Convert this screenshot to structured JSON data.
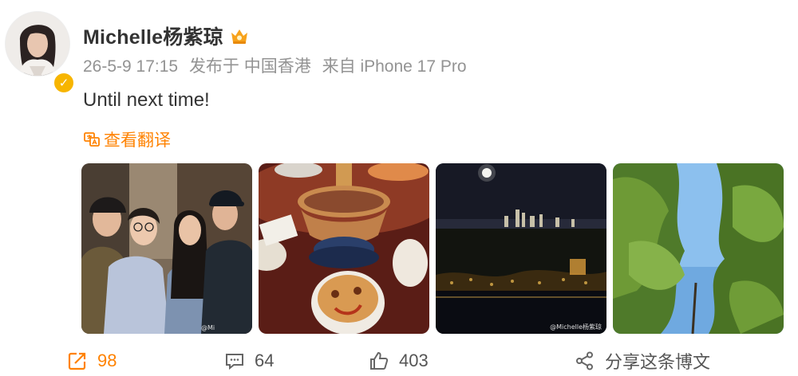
{
  "post": {
    "author_name": "Michelle杨紫琼",
    "meta": {
      "date": "26-5-9 17:15",
      "location": "发布于 中国香港",
      "source": "来自 iPhone 17 Pro"
    },
    "text": "Until next time!",
    "translate_label": "查看翻译",
    "photos": [
      {
        "name": "group-photo",
        "watermark": "@Mi"
      },
      {
        "name": "hotpot-photo",
        "watermark": ""
      },
      {
        "name": "night-city-photo",
        "watermark": "@Michelle杨紫琼"
      },
      {
        "name": "trees-sky-photo",
        "watermark": ""
      }
    ]
  },
  "actions": {
    "repost_count": "98",
    "comment_count": "64",
    "like_count": "403",
    "share_label": "分享这条博文"
  },
  "colors": {
    "accent": "#ff8200",
    "verified_badge": "#f7b500",
    "meta_text": "#939393"
  },
  "icons": [
    "vip-crown-icon",
    "verified-badge-icon",
    "translate-icon",
    "repost-icon",
    "comment-icon",
    "like-icon",
    "share-icon"
  ]
}
